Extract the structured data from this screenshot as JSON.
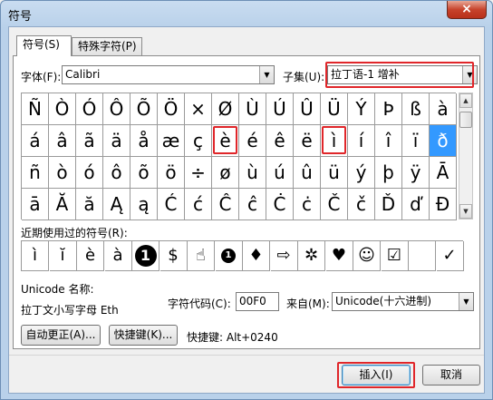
{
  "window": {
    "title": "符号",
    "close_label": "×"
  },
  "tabs": [
    {
      "label": "符号(S)"
    },
    {
      "label": "特殊字符(P)"
    }
  ],
  "font": {
    "label": "字体(F):",
    "value": "Calibri"
  },
  "subset": {
    "label": "子集(U):",
    "value": "拉丁语-1 增补"
  },
  "symbol_grid": {
    "rows": [
      [
        "Ñ",
        "Ò",
        "Ó",
        "Ô",
        "Õ",
        "Ö",
        "×",
        "Ø",
        "Ù",
        "Ú",
        "Û",
        "Ü",
        "Ý",
        "Þ",
        "ß",
        "à"
      ],
      [
        "á",
        "â",
        "ã",
        "ä",
        "å",
        "æ",
        "ç",
        "è",
        "é",
        "ê",
        "ë",
        "ì",
        "í",
        "î",
        "ï",
        "ð"
      ],
      [
        "ñ",
        "ò",
        "ó",
        "ô",
        "õ",
        "ö",
        "÷",
        "ø",
        "ù",
        "ú",
        "û",
        "ü",
        "ý",
        "þ",
        "ÿ",
        "Ā"
      ],
      [
        "ā",
        "Ă",
        "ă",
        "Ą",
        "ą",
        "Ć",
        "ć",
        "Ĉ",
        "ĉ",
        "Ċ",
        "ċ",
        "Č",
        "č",
        "Ď",
        "ď",
        "Đ"
      ]
    ],
    "selected": "ð",
    "highlighted": [
      "è",
      "ì"
    ]
  },
  "recent": {
    "label": "近期使用过的符号(R):",
    "items": [
      "ì",
      "ĭ",
      "è",
      "à",
      "1",
      "$",
      "☝",
      "1",
      "♦",
      "⇨",
      "✲",
      "♥",
      "☺",
      "☑",
      "",
      "✓"
    ]
  },
  "unicode_name": {
    "label": "Unicode 名称:",
    "value": "拉丁文小写字母 Eth"
  },
  "char_code": {
    "label": "字符代码(C):",
    "value": "00F0"
  },
  "from": {
    "label": "来自(M):",
    "value": "Unicode(十六进制)"
  },
  "buttons": {
    "autocorrect": "自动更正(A)...",
    "shortcut_key": "快捷键(K)...",
    "shortcut_text": "快捷键: Alt+0240",
    "insert": "插入(I)",
    "cancel": "取消"
  },
  "colors": {
    "selection": "#3399ff",
    "annotation": "#e0262a"
  }
}
